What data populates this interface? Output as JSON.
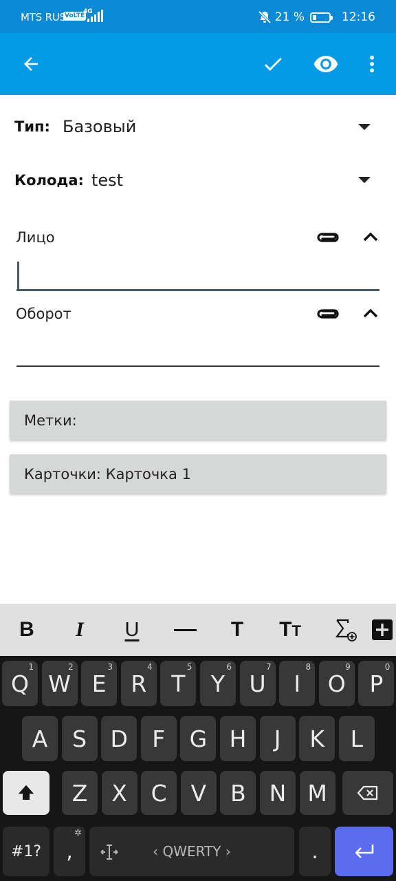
{
  "status": {
    "carrier": "MTS RUS",
    "volte": "VoLTE",
    "network": "4G",
    "battery": "21 %",
    "battery_fraction": 0.21,
    "time": "12:16"
  },
  "appbar": {
    "icons": [
      "back-arrow-icon",
      "check-icon",
      "eye-icon",
      "more-vert-icon"
    ]
  },
  "form": {
    "type_label": "Тип:",
    "type_value": "Базовый",
    "deck_label": "Колода:",
    "deck_value": "test",
    "front_label": "Лицо",
    "front_value": "",
    "back_label": "Оборот",
    "back_value": "",
    "tags_label": "Метки:",
    "cards_label": "Карточки: Карточка 1"
  },
  "toolbar": {
    "buttons": [
      "bold-icon",
      "italic-icon",
      "underline-icon",
      "horizontal-rule-icon",
      "title-icon",
      "font-size-icon",
      "math-icon",
      "add-icon"
    ],
    "bold": "B",
    "italic": "I",
    "underline": "U",
    "title": "T",
    "fontsize_big": "T",
    "fontsize_small": "T"
  },
  "keyboard": {
    "row1": [
      {
        "k": "Q",
        "n": "1"
      },
      {
        "k": "W",
        "n": "2"
      },
      {
        "k": "E",
        "n": "3"
      },
      {
        "k": "R",
        "n": "4"
      },
      {
        "k": "T",
        "n": "5"
      },
      {
        "k": "Y",
        "n": "6"
      },
      {
        "k": "U",
        "n": "7"
      },
      {
        "k": "I",
        "n": "8"
      },
      {
        "k": "O",
        "n": "9"
      },
      {
        "k": "P",
        "n": "0"
      }
    ],
    "row2": [
      "A",
      "S",
      "D",
      "F",
      "G",
      "H",
      "J",
      "K",
      "L"
    ],
    "row3": [
      "Z",
      "X",
      "C",
      "V",
      "B",
      "N",
      "M"
    ],
    "symbols": "#1?",
    "comma": ",",
    "space_label": "‹ QWERTY ›",
    "period": "."
  }
}
